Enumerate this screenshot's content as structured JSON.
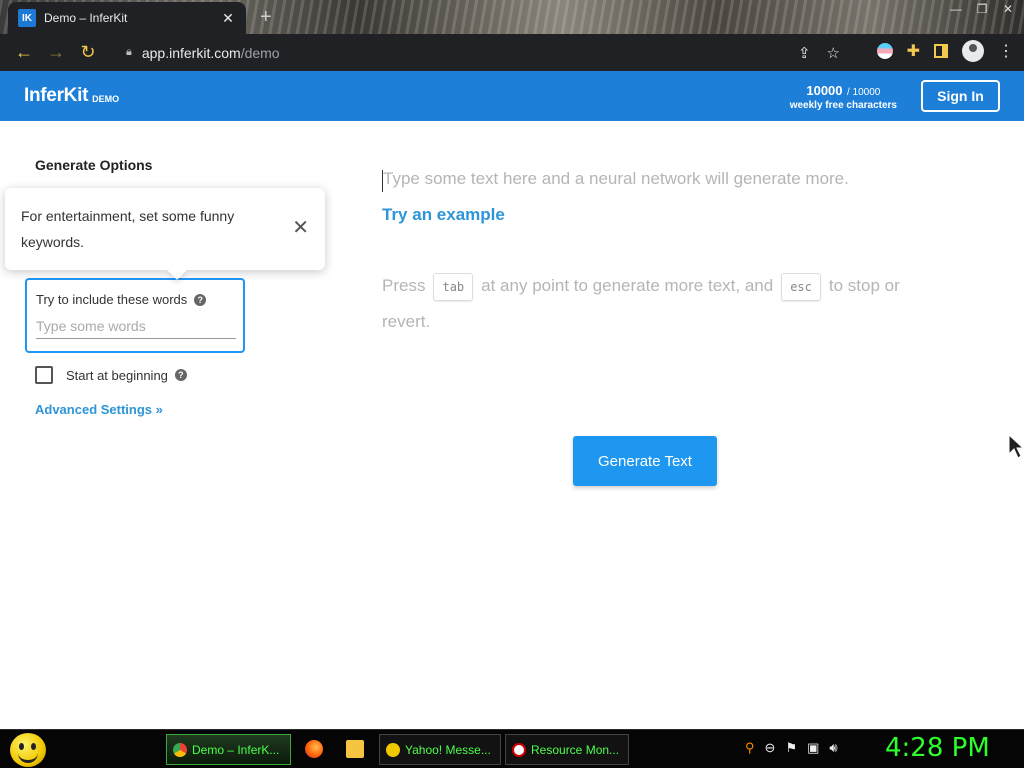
{
  "browser": {
    "tab_title": "Demo – InferKit",
    "favicon_text": "IK",
    "tab_close": "✕",
    "new_tab": "+",
    "url_host": "app.inferkit.com",
    "url_path": "/demo"
  },
  "header": {
    "brand": "InferKit",
    "brand_sub": "DEMO",
    "quota_used": "10000",
    "quota_max": "/ 10000",
    "quota_label": "weekly free characters",
    "signin_label": "Sign In"
  },
  "options": {
    "title": "Generate Options",
    "keywords_label": "Try to include these words",
    "keywords_placeholder": "Type some words",
    "keywords_value": "",
    "start_label": "Start at beginning",
    "advanced_link": "Advanced Settings »"
  },
  "tooltip": {
    "text": "For entertainment, set some funny keywords.",
    "close": "✕"
  },
  "editor": {
    "placeholder": "Type some text here and a neural network will generate more.",
    "example_link": "Try an example",
    "hint_press": "Press",
    "hint_key_tab": "tab",
    "hint_mid": "at any point to generate more text, and",
    "hint_key_esc": "esc",
    "hint_end": "to stop or revert.",
    "generate_label": "Generate Text"
  },
  "taskbar": {
    "items": [
      {
        "label": "Demo – InferK..."
      },
      {
        "label": "Yahoo! Messe..."
      },
      {
        "label": "Resource Mon..."
      }
    ],
    "clock": "4:28 PM"
  },
  "colors": {
    "header_blue": "#1e7fd8",
    "link_blue": "#2d95d8",
    "button_blue": "#1e97f0",
    "taskbar_green": "#2dff2d"
  }
}
